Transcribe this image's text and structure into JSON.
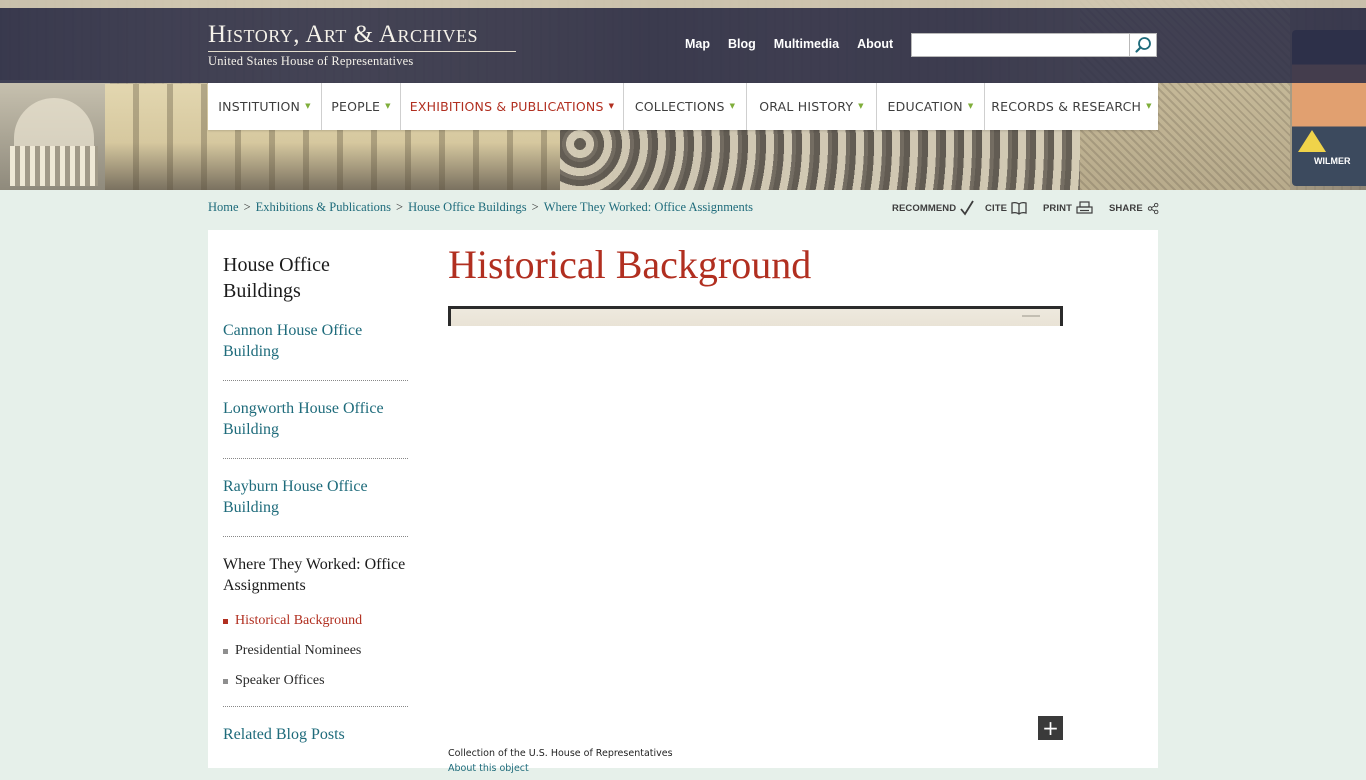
{
  "logo": {
    "title": "History, Art & Archives",
    "subtitle": "United States House of Representatives"
  },
  "util_nav": [
    "Map",
    "Blog",
    "Multimedia",
    "About"
  ],
  "search": {
    "value": "",
    "placeholder": ""
  },
  "main_nav": [
    {
      "label": "INSTITUTION",
      "active": false
    },
    {
      "label": "PEOPLE",
      "active": false
    },
    {
      "label": "EXHIBITIONS & PUBLICATIONS",
      "active": true
    },
    {
      "label": "COLLECTIONS",
      "active": false
    },
    {
      "label": "ORAL HISTORY",
      "active": false
    },
    {
      "label": "EDUCATION",
      "active": false
    },
    {
      "label": "RECORDS & RESEARCH",
      "active": false
    }
  ],
  "banner": {
    "card_tag": "WILMER"
  },
  "breadcrumb": [
    "Home",
    "Exhibitions & Publications",
    "House Office Buildings",
    "Where They Worked: Office Assignments"
  ],
  "tools": {
    "recommend": "RECOMMEND",
    "cite": "CITE",
    "print": "PRINT",
    "share": "SHARE"
  },
  "sidebar": {
    "title": "House Office Buildings",
    "links": [
      "Cannon House Office Building",
      "Longworth House Office Building",
      "Rayburn House Office Building"
    ],
    "section": "Where They Worked: Office Assignments",
    "subitems": [
      {
        "label": "Historical Background",
        "active": true
      },
      {
        "label": "Presidential Nominees",
        "active": false
      },
      {
        "label": "Speaker Offices",
        "active": false
      }
    ],
    "related": "Related Blog Posts"
  },
  "page": {
    "title": "Historical Background",
    "credit": "Collection of the U.S. House of Representatives",
    "about_link": "About this object",
    "expand_symbol": "+"
  },
  "colors": {
    "accent_red": "#b12f20",
    "link_teal": "#1e6b7b",
    "nav_arrow_green": "#7fae3a",
    "topbar_navy": "#2d2f48",
    "page_bg": "#e6f0ea"
  }
}
